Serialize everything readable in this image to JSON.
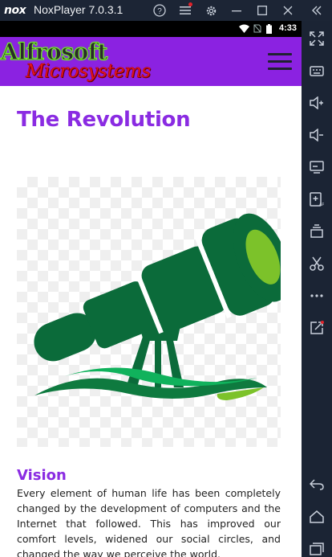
{
  "window": {
    "brand": "nox",
    "title": "NoxPlayer 7.0.3.1"
  },
  "status_bar": {
    "time": "4:33"
  },
  "site": {
    "logo_line1": "Alfrosoft",
    "logo_line2": "Microsystems"
  },
  "page": {
    "title": "The Revolution",
    "section_heading": "Vision",
    "section_body": "Every element of human life has been completely changed by the development of computers and the Internet that followed. This has improved our comfort levels, widened our social circles, and changed the way we perceive the world."
  },
  "colors": {
    "header_bg": "#8b22e1",
    "accent_purple": "#8a2be2",
    "telescope_dark_green": "#0b6b3a",
    "telescope_lens": "#7cc22a"
  }
}
